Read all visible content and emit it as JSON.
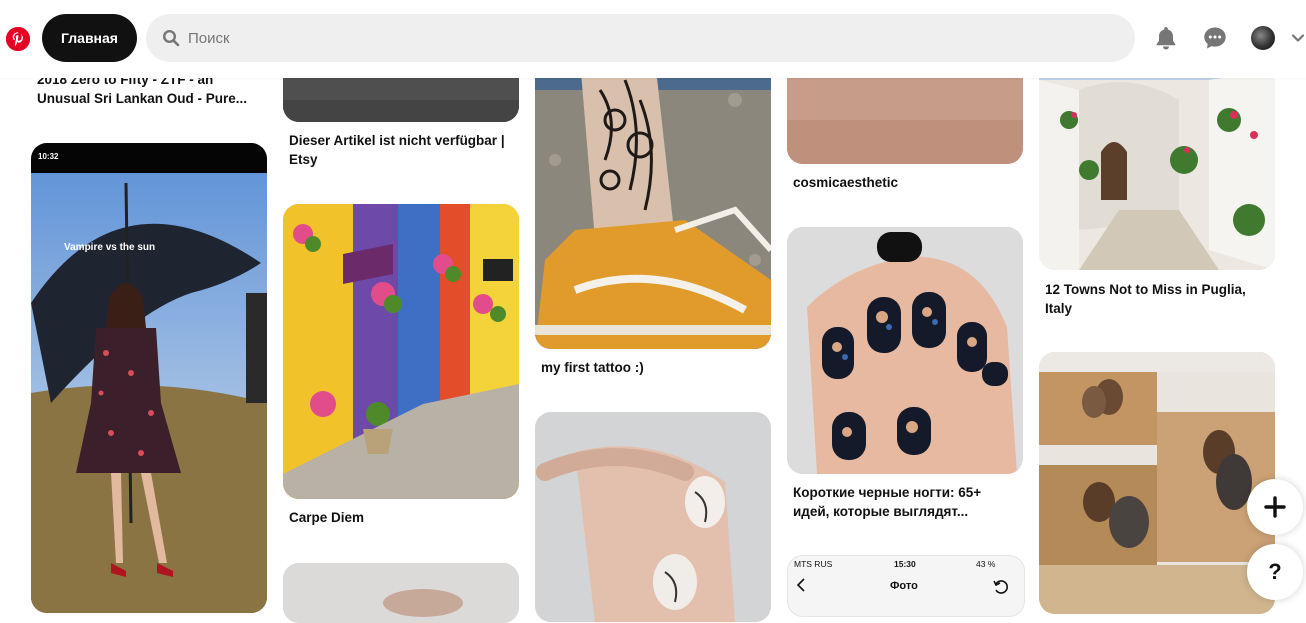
{
  "header": {
    "home_label": "Главная",
    "search_placeholder": "Поиск"
  },
  "phone_status": {
    "left_time": "10:32",
    "right_carrier": "MTS RUS",
    "right_time": "15:30",
    "right_battery": "43 %",
    "photo_title": "Фото"
  },
  "pins": {
    "col1_top_caption_line1": "2018 Zero to Fifty - ZTF - an",
    "col1_top_caption_line2": "Unusual Sri Lankan Oud - Pure...",
    "vampire_overlay": "Vampire vs the sun",
    "col2_top_caption_line1": "Dieser Artikel ist nicht verfügbar |",
    "col2_top_caption_line2": "Etsy",
    "carpe_caption": "Carpe Diem",
    "tattoo_caption": "my first tattoo :)",
    "cosmic_caption": "cosmicaesthetic",
    "nails_caption_line1": "Короткие черные ногти: 65+",
    "nails_caption_line2": "идей, которые выглядят...",
    "puglia_caption_line1": "12 Towns Not to Miss in Puglia,",
    "puglia_caption_line2": "Italy"
  },
  "colors": {
    "brand": "#e60023",
    "home_bg": "#111111",
    "search_bg": "#efefef"
  }
}
